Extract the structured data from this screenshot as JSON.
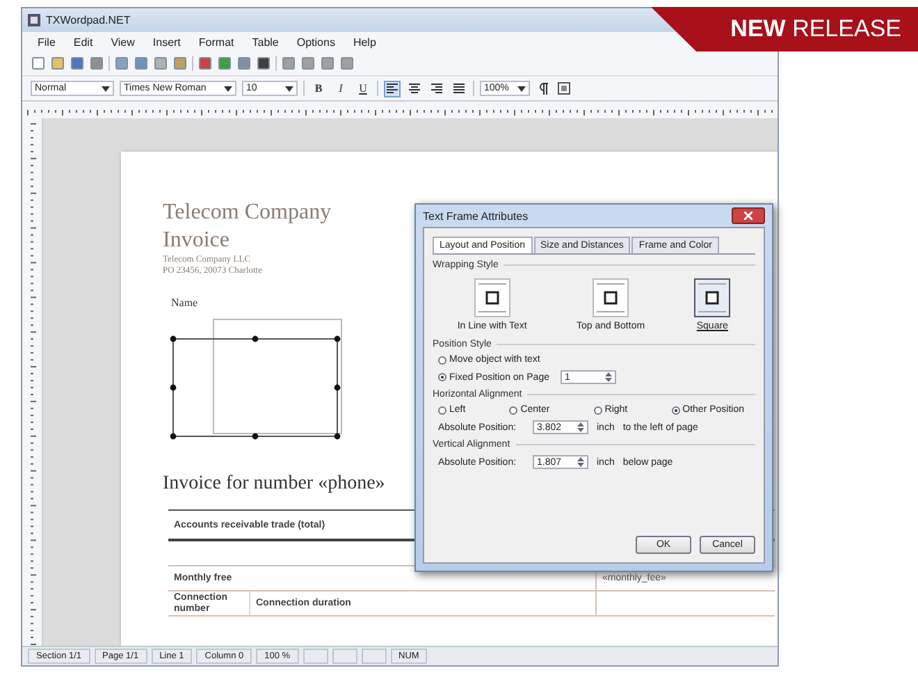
{
  "window": {
    "title": "TXWordpad.NET"
  },
  "banner": {
    "text": "**NEW** RELEASE"
  },
  "menu": [
    "File",
    "Edit",
    "View",
    "Insert",
    "Format",
    "Table",
    "Options",
    "Help"
  ],
  "format_bar": {
    "style": "Normal",
    "font": "Times New Roman",
    "size": "10",
    "text_buttons": [
      {
        "label": "B",
        "kind": "bold",
        "selected": false
      },
      {
        "label": "I",
        "kind": "italic",
        "selected": false
      },
      {
        "label": "U",
        "kind": "underline",
        "selected": false
      }
    ],
    "align_buttons": [
      {
        "selected": true
      },
      {
        "selected": false
      },
      {
        "selected": false
      },
      {
        "selected": false
      }
    ],
    "zoom": "100%"
  },
  "document": {
    "title": "Telecom Company",
    "subtitle": "Invoice",
    "address": [
      "Telecom Company LLC",
      "PO 23456, 20073 Charlotte"
    ],
    "name_label": "Name",
    "heading": "Invoice for number «phone»",
    "rows": [
      {
        "kind": "header",
        "cells": [
          "Accounts receivable trade (total)",
          ""
        ]
      },
      {
        "kind": "blank",
        "cells": [
          "",
          ""
        ]
      },
      {
        "kind": "plain",
        "cells": [
          "Monthly free",
          "«monthly_fee»"
        ]
      }
    ],
    "detail_row": {
      "cells": [
        "Connection number",
        "Connection duration"
      ]
    }
  },
  "dialog": {
    "title": "Text Frame Attributes",
    "tabs": [
      {
        "label": "Layout and Position",
        "selected": true
      },
      {
        "label": "Size and Distances",
        "selected": false
      },
      {
        "label": "Frame and Color",
        "selected": false
      }
    ],
    "wrapping_style": {
      "label": "Wrapping Style",
      "options": [
        {
          "label": "In Line with Text",
          "selected": false
        },
        {
          "label": "Top and Bottom",
          "selected": false
        },
        {
          "label": "Square",
          "selected": true
        }
      ]
    },
    "position_style": {
      "label": "Position Style",
      "options": [
        {
          "label": "Move object with text",
          "checked": false
        },
        {
          "label": "Fixed Position on Page",
          "checked": true
        }
      ],
      "page": "1"
    },
    "horizontal": {
      "label": "Horizontal Alignment",
      "options": [
        {
          "label": "Left",
          "checked": false
        },
        {
          "label": "Center",
          "checked": false
        },
        {
          "label": "Right",
          "checked": false
        },
        {
          "label": "Other Position",
          "checked": true
        }
      ],
      "position_label": "Absolute Position:",
      "value": "3.802",
      "unit": "inch",
      "note": "to the left of page"
    },
    "vertical": {
      "label": "Vertical Alignment",
      "position_label": "Absolute Position:",
      "value": "1.807",
      "unit": "inch",
      "note": "below page"
    },
    "buttons": [
      "OK",
      "Cancel"
    ]
  },
  "status_bar": [
    "Section 1/1",
    "Page 1/1",
    "Line 1",
    "Column 0",
    "100 %",
    "NUM"
  ]
}
